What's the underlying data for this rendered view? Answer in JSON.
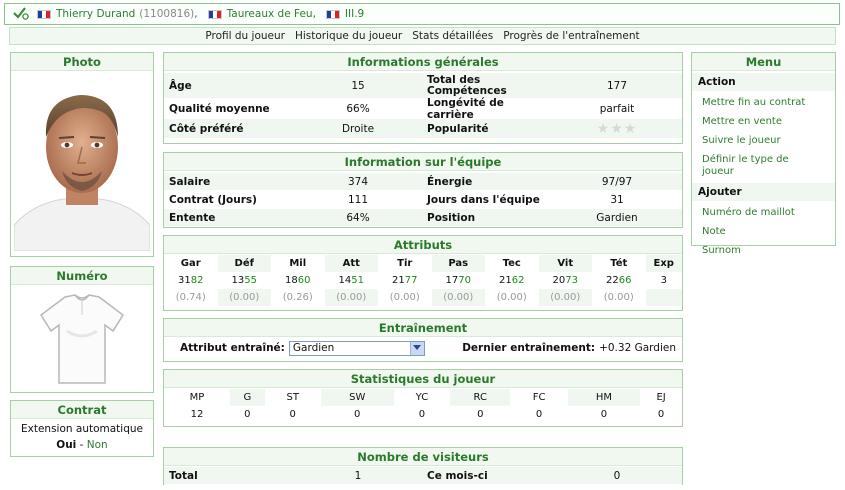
{
  "header": {
    "player_name": "Thierry Durand",
    "player_id": "(1100816)",
    "team": "Taureaux de Feu",
    "league": "III.9"
  },
  "nav": [
    "Profil du joueur",
    "Historique du joueur",
    "Stats détaillées",
    "Progrès de l'entraînement"
  ],
  "photo": {
    "title": "Photo"
  },
  "numero": {
    "title": "Numéro"
  },
  "contrat": {
    "title": "Contrat",
    "label": "Extension automatique",
    "yes": "Oui",
    "dash": "-",
    "no": "Non"
  },
  "general": {
    "title": "Informations générales",
    "rows": [
      {
        "l1": "Âge",
        "v1": "15",
        "l2": "Total des Compétences",
        "v2": "177"
      },
      {
        "l1": "Qualité moyenne",
        "v1": "66%",
        "l2": "Longévité de carrière",
        "v2": "parfait"
      },
      {
        "l1": "Côté préféré",
        "v1": "Droite",
        "l2": "Popularité",
        "v2": ""
      }
    ],
    "popularity_stars": 0
  },
  "team": {
    "title": "Information sur l'équipe",
    "rows": [
      {
        "l1": "Salaire",
        "v1": "374",
        "l2": "Énergie",
        "v2": "97/97"
      },
      {
        "l1": "Contrat (Jours)",
        "v1": "111",
        "l2": "Jours dans l'équipe",
        "v2": "31"
      },
      {
        "l1": "Entente",
        "v1": "64%",
        "l2": "Position",
        "v2": "Gardien"
      }
    ]
  },
  "attributes": {
    "title": "Attributs",
    "items": [
      {
        "name": "Gar",
        "base": "31",
        "cur": "82",
        "delta": "(0.74)"
      },
      {
        "name": "Déf",
        "base": "13",
        "cur": "55",
        "delta": "(0.00)"
      },
      {
        "name": "Mil",
        "base": "18",
        "cur": "60",
        "delta": "(0.26)"
      },
      {
        "name": "Att",
        "base": "14",
        "cur": "51",
        "delta": "(0.00)"
      },
      {
        "name": "Tir",
        "base": "21",
        "cur": "77",
        "delta": "(0.00)"
      },
      {
        "name": "Pas",
        "base": "17",
        "cur": "70",
        "delta": "(0.00)"
      },
      {
        "name": "Tec",
        "base": "21",
        "cur": "62",
        "delta": "(0.00)"
      },
      {
        "name": "Vit",
        "base": "20",
        "cur": "73",
        "delta": "(0.00)"
      },
      {
        "name": "Tét",
        "base": "22",
        "cur": "66",
        "delta": "(0.00)"
      },
      {
        "name": "Exp",
        "base": "3",
        "cur": "",
        "delta": ""
      }
    ]
  },
  "training": {
    "title": "Entraînement",
    "attr_label": "Attribut entraîné:",
    "selected": "Gardien",
    "last_label": "Dernier entraînement:",
    "last_value": "+0.32 Gardien"
  },
  "stats": {
    "title": "Statistiques du joueur",
    "headers": [
      "MP",
      "G",
      "ST",
      "SW",
      "YC",
      "RC",
      "FC",
      "HM",
      "EJ"
    ],
    "values": [
      "12",
      "0",
      "0",
      "0",
      "0",
      "0",
      "0",
      "0",
      "0"
    ]
  },
  "visitors": {
    "title": "Nombre de visiteurs",
    "total_label": "Total",
    "total_value": "1",
    "month_label": "Ce mois-ci",
    "month_value": "0"
  },
  "menu": {
    "title": "Menu",
    "action_head": "Action",
    "actions": [
      "Mettre fin au contrat",
      "Mettre en vente",
      "Suivre le joueur",
      "Définir le type de joueur"
    ],
    "add_head": "Ajouter",
    "adds": [
      "Numéro de maillot",
      "Note",
      "Surnom"
    ]
  }
}
